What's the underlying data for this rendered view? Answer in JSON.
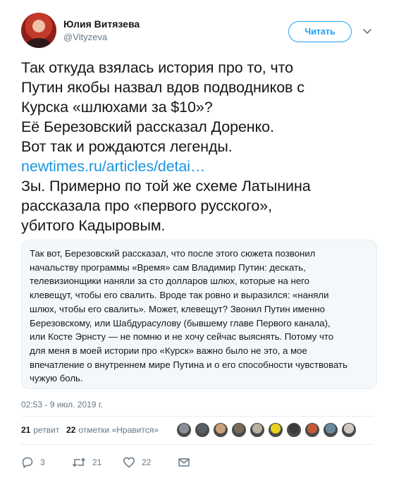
{
  "author": {
    "name": "Юлия Витязева",
    "handle": "@Vityzeva"
  },
  "follow_label": "Читать",
  "tweet_lines": [
    "Так откуда взялась история про то, что",
    "Путин якобы назвал вдов подводников с",
    "Курска «шлюхами за $10»?",
    "Её Березовский рассказал Доренко.",
    "Вот так и рождаются легенды."
  ],
  "tweet_link": "newtimes.ru/articles/detai…",
  "tweet_lines_after": [
    "Зы. Примерно по той же схеме Латынина",
    "рассказала про «первого русского»,",
    "убитого Кадыровым."
  ],
  "quote_lines": [
    "Так вот, Березовский рассказал, что после этого сюжета позвонил",
    "начальству программы «Время» сам Владимир Путин: дескать,",
    "телевизионщики наняли за сто долларов шлюх, которые на него",
    "клевещут, чтобы его свалить. Вроде так ровно и выразился: «наняли",
    "шлюх, чтобы его свалить». Может, клевещут? Звонил Путин именно",
    "Березовскому, или Шабдурасулову (бывшему главе Первого канала),",
    "или Косте Эрнсту — не помню и не хочу сейчас выяснять. Потому что",
    "для меня в моей истории про «Курск» важно было не это, а мое",
    "впечатление о внутреннем мире Путина и о его способности чувствовать",
    "чужую боль."
  ],
  "timestamp": "02:53 - 9 июл. 2019 г.",
  "stats": {
    "retweets_count": "21",
    "retweets_label": "ретвит",
    "likes_count": "22",
    "likes_label": "отметки «Нравится»"
  },
  "liker_colors": [
    "#8a8f96",
    "#5a5f66",
    "#c9a27a",
    "#7a6a5a",
    "#b8b0a0",
    "#e8d21a",
    "#3a3a3a",
    "#c25a3a",
    "#6a8aa0",
    "#d0c8c0"
  ],
  "actions": {
    "replies": "3",
    "retweets": "21",
    "likes": "22"
  },
  "colors": {
    "accent": "#1da1f2",
    "link": "#1b95e0",
    "muted": "#657786"
  }
}
